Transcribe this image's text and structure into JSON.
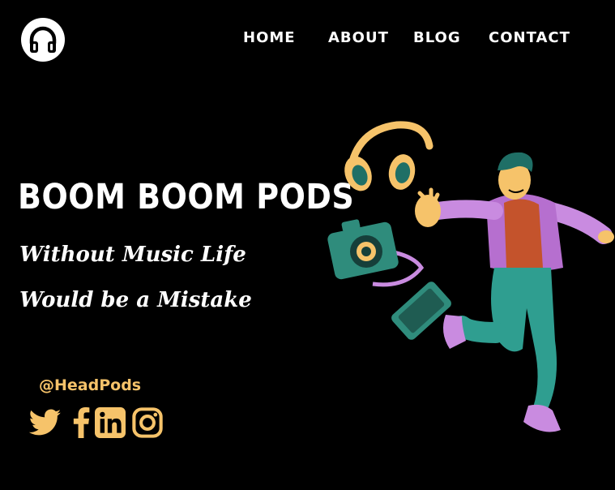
{
  "brand": {
    "logo_icon": "headphones-icon",
    "logo_bg_color": "#ffffff"
  },
  "nav": {
    "items": [
      {
        "label": "HOME"
      },
      {
        "label": "ABOUT"
      },
      {
        "label": "BLOG"
      },
      {
        "label": "CONTACT"
      }
    ]
  },
  "hero": {
    "title": "BOOM BOOM PODS",
    "tagline": "Without Music Life Would be a Mistake"
  },
  "social": {
    "handle": "@HeadPods",
    "accent_color": "#f6c36a",
    "icons": [
      "twitter-icon",
      "facebook-icon",
      "linkedin-icon",
      "instagram-icon"
    ]
  },
  "colors": {
    "background": "#000000",
    "text": "#ffffff",
    "accent": "#f6c36a"
  }
}
